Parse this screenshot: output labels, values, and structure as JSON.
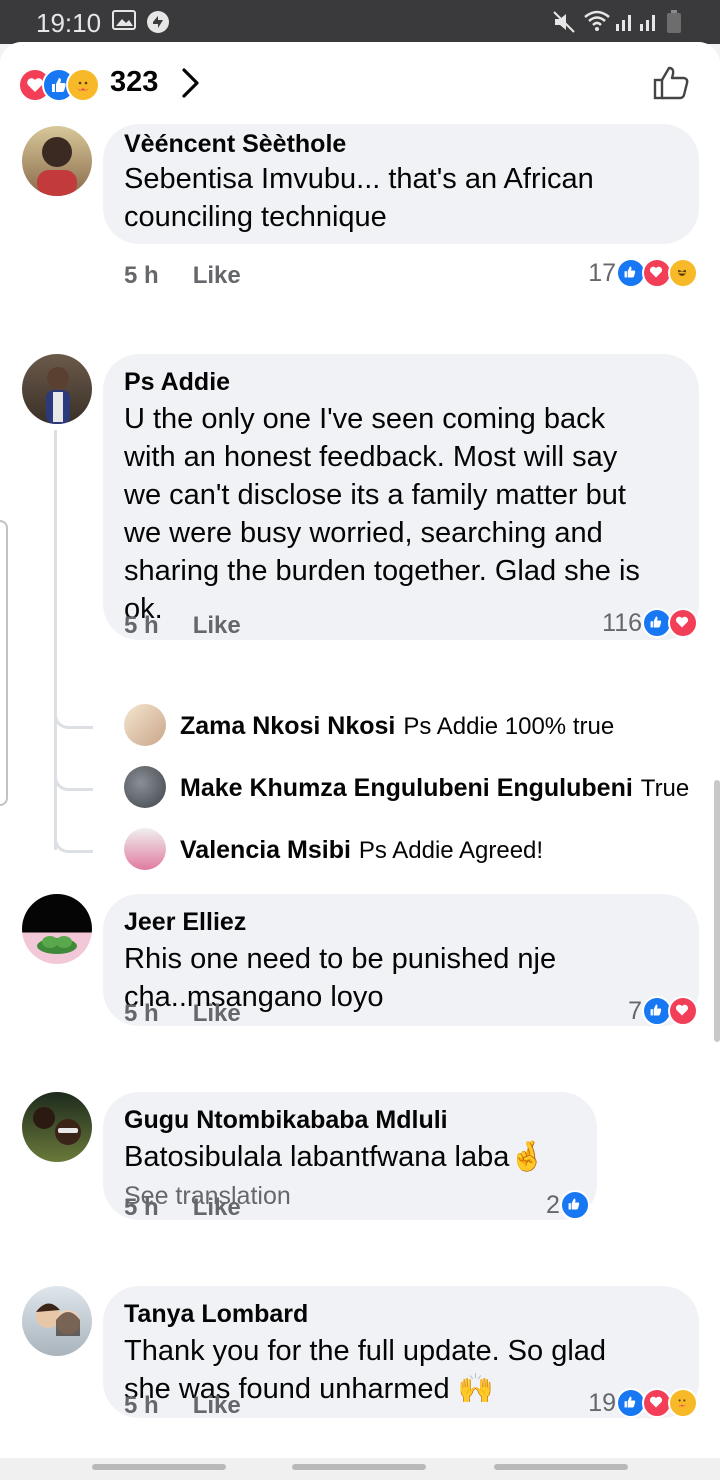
{
  "status_bar": {
    "time": "19:10"
  },
  "header": {
    "reaction_count": "323",
    "reaction_types": [
      "heart-icon",
      "like-icon",
      "care-icon"
    ]
  },
  "colors": {
    "like": "#1877f2",
    "love": "#f33e58",
    "haha": "#f7b928",
    "meta_text": "#65676b",
    "bubble": "#f0f2f5"
  },
  "comments": [
    {
      "author": "Vèéncent Sèèthole",
      "text": "Sebentisa Imvubu... that's an African\ncounciling technique",
      "time": "5 h",
      "like_label": "Like",
      "reaction_count": "17",
      "reactions": [
        "like",
        "heart",
        "haha"
      ]
    },
    {
      "author": "Ps Addie",
      "text": "U the only one I've seen coming back\nwith an honest feedback. Most will say\nwe can't disclose its a family matter but\nwe were busy worried, searching and\nsharing the burden together. Glad she is\nok.",
      "time": "5 h",
      "like_label": "Like",
      "reaction_count": "116",
      "reactions": [
        "like",
        "heart"
      ],
      "replies": [
        {
          "author": "Zama Nkosi Nkosi",
          "text": "Ps Addie 100% true"
        },
        {
          "author": "Make Khumza Engulubeni Engulubeni",
          "text": "True"
        },
        {
          "author": "Valencia Msibi",
          "text": "Ps Addie Agreed!"
        }
      ]
    },
    {
      "author": "Jeer Elliez",
      "text": "Rhis one need to be punished nje\ncha..msangano loyo",
      "time": "5 h",
      "like_label": "Like",
      "reaction_count": "7",
      "reactions": [
        "like",
        "heart"
      ]
    },
    {
      "author": "Gugu Ntombikababa Mdluli",
      "text": "Batosibulala labantfwana laba🤞",
      "see_translation": "See translation",
      "time": "5 h",
      "like_label": "Like",
      "reaction_count": "2",
      "reactions": [
        "like"
      ]
    },
    {
      "author": "Tanya Lombard",
      "text": "Thank you for the full update. So glad\nshe was found unharmed 🙌",
      "time": "5 h",
      "like_label": "Like",
      "reaction_count": "19",
      "reactions": [
        "like",
        "heart",
        "haha"
      ]
    }
  ]
}
